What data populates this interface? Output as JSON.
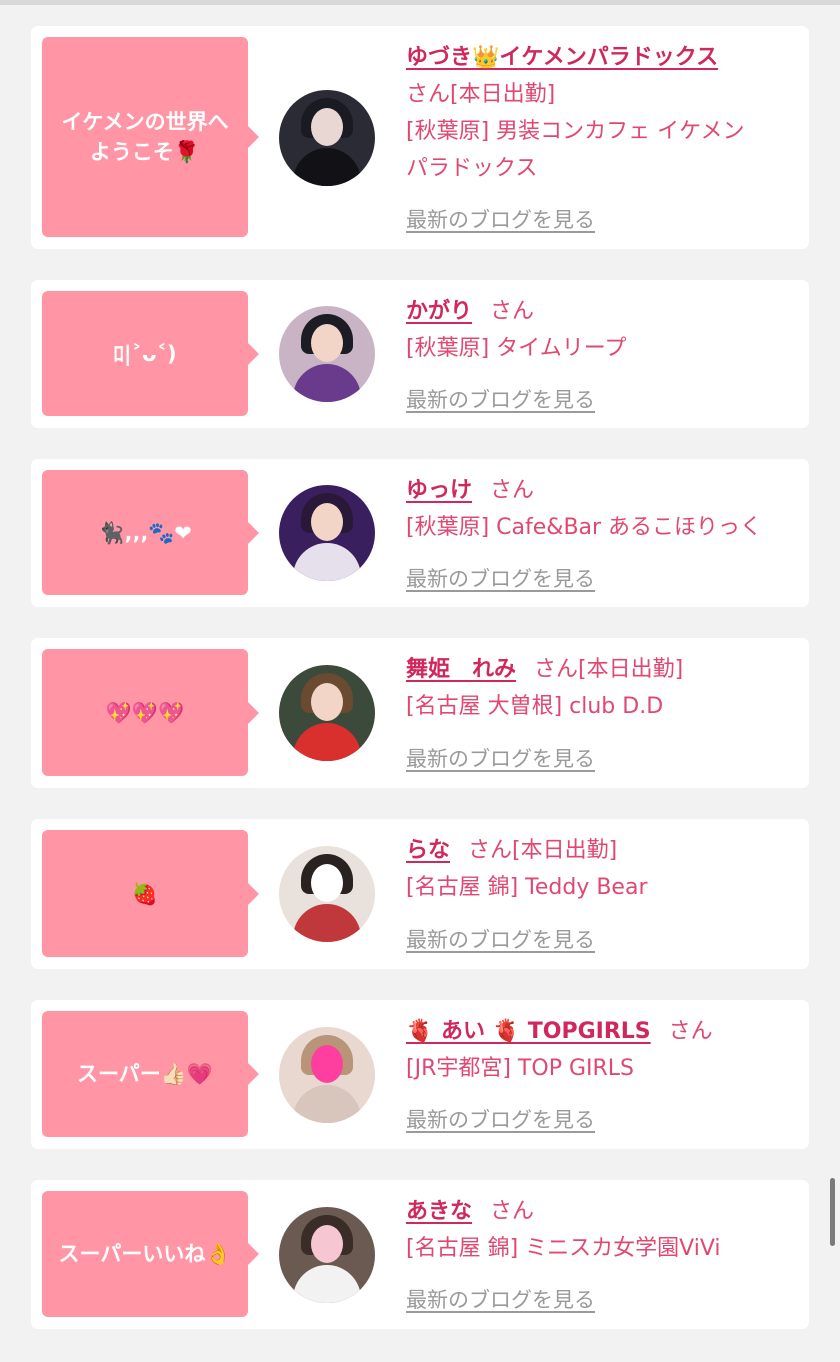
{
  "blog_link_label": "最新のブログを見る",
  "colors": {
    "bubble": "#ff95a5",
    "name": "#d0285c",
    "text": "#e04872",
    "link_gray": "#9a9a9a"
  },
  "entries": [
    {
      "bubble": "イケメンの世界へ\nようこそ🌹",
      "name": "ゆづき👑イケメンパラドックス",
      "suffix": "さん[本日出勤]",
      "shop": "[秋葉原] 男装コンカフェ イケメン\nパラドックス",
      "avatar": "avatar-male-host"
    },
    {
      "bubble": "ﾛ|˃ᴗ˂)",
      "name": "かがり",
      "suffix": "さん",
      "shop": "[秋葉原] タイムリープ",
      "avatar": "avatar-girl-purple"
    },
    {
      "bubble": "🐈‍⬛‚‚‚🐾❤",
      "name": "ゆっけ",
      "suffix": "さん",
      "shop": "[秋葉原] Cafe&Bar あるこほりっく",
      "avatar": "avatar-girl-nurse"
    },
    {
      "bubble": "💖💖💖",
      "name": "舞姫　れみ",
      "suffix": "さん[本日出勤]",
      "shop": "[名古屋 大曽根] club D.D",
      "avatar": "avatar-woman-red"
    },
    {
      "bubble": "🍓",
      "name": "らな",
      "suffix": "さん[本日出勤]",
      "shop": "[名古屋 錦] Teddy Bear",
      "avatar": "avatar-girl-blurred"
    },
    {
      "bubble": "スーパー👍🏻💗",
      "name": "🫀 あい 🫀 TOPGIRLS",
      "suffix": "さん",
      "shop": "[JR宇都宮] TOP GIRLS",
      "avatar": "avatar-girl-heart-sticker"
    },
    {
      "bubble": "スーパーいいね👌",
      "name": "あきな",
      "suffix": "さん",
      "shop": "[名古屋 錦] ミニスカ女学園ViVi",
      "avatar": "avatar-girl-eye-sticker"
    }
  ]
}
